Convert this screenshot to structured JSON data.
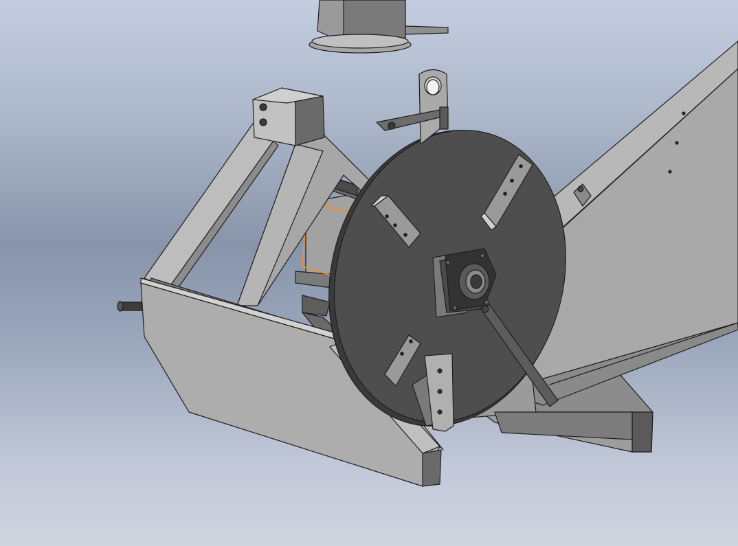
{
  "viewport": {
    "background_top": "#c4cce0",
    "background_mid": "#8894aa",
    "background_bottom": "#cfd4df"
  },
  "model": {
    "parts": [
      "discharge-chute-upper",
      "lifting-eye-bracket",
      "three-point-hitch-frame",
      "hitch-pin",
      "cutting-disc",
      "knife-blade",
      "flange-bearing",
      "infeed-hopper",
      "selected-housing-face",
      "tie-rod"
    ],
    "colors": {
      "steel_light": "#a8a8a8",
      "steel_mid": "#8c8c8c",
      "steel_dark": "#5a5a5a",
      "disc": "#4e4e4e",
      "edge": "#1e1e1e",
      "selection_highlight": "#ff8c1a"
    }
  }
}
